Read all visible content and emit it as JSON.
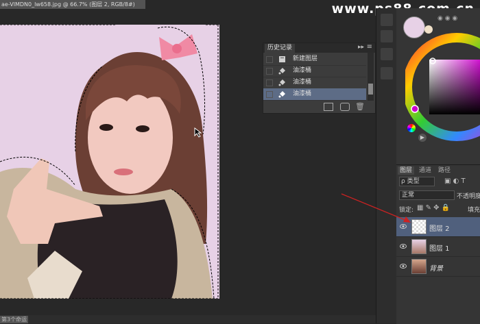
{
  "document": {
    "tab_title": "ae-VlMDN0_lw658.jpg @ 66.7% (图层 2, RGB/8#)"
  },
  "watermark": "www.ps88.com.cn",
  "history_panel": {
    "title": "历史记录",
    "items": [
      {
        "label": "新建图层",
        "icon": "new-layer-icon",
        "active": false
      },
      {
        "label": "油漆桶",
        "icon": "paint-bucket-icon",
        "active": false
      },
      {
        "label": "油漆桶",
        "icon": "paint-bucket-icon",
        "active": false
      },
      {
        "label": "油漆桶",
        "icon": "paint-bucket-icon",
        "active": true
      }
    ]
  },
  "layers_panel": {
    "tabs": [
      "图层",
      "通道",
      "路径"
    ],
    "kind_label": "ρ 类型",
    "blend_mode": "正常",
    "opacity_label": "不透明度",
    "lock_label": "锁定:",
    "fill_label": "填充",
    "layers": [
      {
        "name": "图层 2",
        "active": true,
        "thumb": "transparent"
      },
      {
        "name": "图层 1",
        "active": false,
        "thumb": "photo"
      },
      {
        "name": "背景",
        "active": false,
        "thumb": "photo"
      }
    ]
  },
  "status": {
    "text": "第3个命运"
  },
  "colors": {
    "canvas_bg": "#e7d1e6",
    "foreground": "#e7d1e6",
    "highlight": "#5d6c86",
    "arrow": "#cc2222"
  }
}
